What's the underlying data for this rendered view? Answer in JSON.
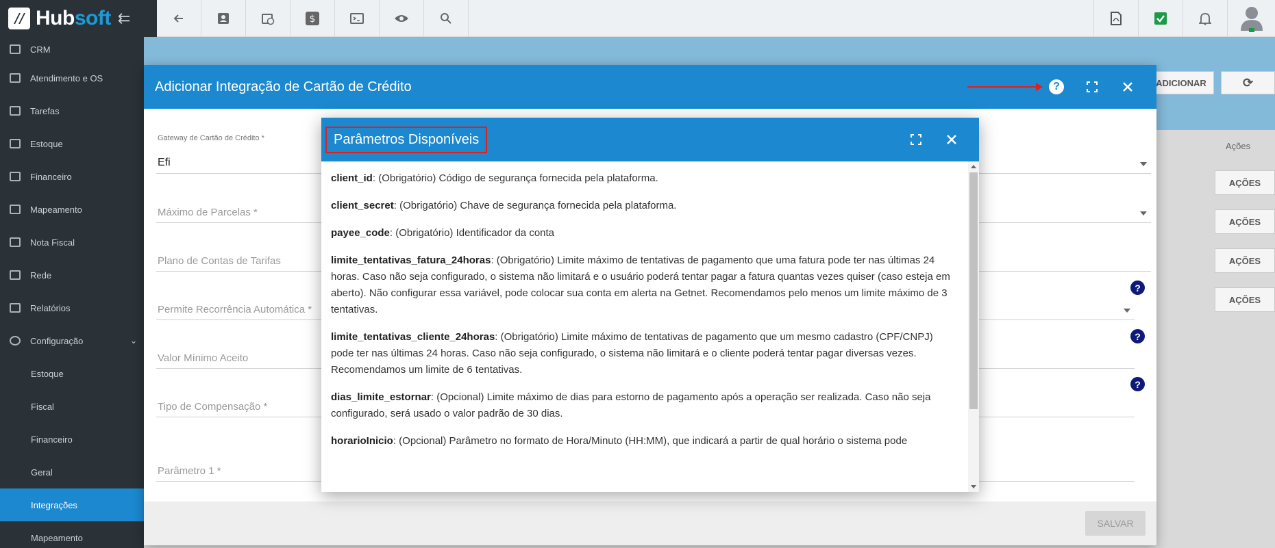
{
  "brand": {
    "name_a": "Hub",
    "name_b": "soft"
  },
  "topbar": {
    "icons": [
      "back-arrow-icon",
      "contact-card-icon",
      "clock-calendar-icon",
      "dollar-icon",
      "terminal-icon",
      "eye-icon",
      "search-icon"
    ],
    "right_icons": [
      "pdf-icon",
      "check-badge-icon",
      "bell-icon",
      "user-avatar-icon"
    ]
  },
  "sidebar": {
    "items": [
      {
        "label": "CRM"
      },
      {
        "label": "Atendimento e OS"
      },
      {
        "label": "Tarefas"
      },
      {
        "label": "Estoque"
      },
      {
        "label": "Financeiro"
      },
      {
        "label": "Mapeamento"
      },
      {
        "label": "Nota Fiscal"
      },
      {
        "label": "Rede"
      },
      {
        "label": "Relatórios"
      },
      {
        "label": "Configuração"
      }
    ],
    "subitems": [
      {
        "label": "Estoque"
      },
      {
        "label": "Fiscal"
      },
      {
        "label": "Financeiro"
      },
      {
        "label": "Geral"
      },
      {
        "label": "Integrações"
      },
      {
        "label": "Mapeamento"
      }
    ]
  },
  "background": {
    "adicionar_label": "ADICIONAR",
    "acoes_header": "Ações",
    "acoes_button": "AÇÕES"
  },
  "modal": {
    "title": "Adicionar Integração de Cartão de Crédito",
    "gateway_label": "Gateway de Cartão de Crédito *",
    "gateway_value": "Efi",
    "max_parcelas": "Máximo de Parcelas *",
    "plano_contas": "Plano de Contas de Tarifas",
    "recorrencia": "Permite Recorrência Automática *",
    "valor_minimo": "Valor Mínimo Aceito",
    "tipo_compensacao": "Tipo de Compensação *",
    "parametro1": "Parâmetro 1 *",
    "save_label": "SALVAR",
    "help_glyph": "?"
  },
  "params_dialog": {
    "title": "Parâmetros Disponíveis",
    "params": [
      {
        "name": "client_id",
        "desc": ": (Obrigatório) Código de segurança fornecida pela plataforma."
      },
      {
        "name": "client_secret",
        "desc": ": (Obrigatório) Chave de segurança fornecida pela plataforma."
      },
      {
        "name": "payee_code",
        "desc": ": (Obrigatório) Identificador da conta"
      },
      {
        "name": "limite_tentativas_fatura_24horas",
        "desc": ": (Obrigatório) Limite máximo de tentativas de pagamento que uma fatura pode ter nas últimas 24 horas. Caso não seja configurado, o sistema não limitará e o usuário poderá tentar pagar a fatura quantas vezes quiser (caso esteja em aberto). Não configurar essa variável, pode colocar sua conta em alerta na Getnet. Recomendamos pelo menos um limite máximo de 3 tentativas."
      },
      {
        "name": "limite_tentativas_cliente_24horas",
        "desc": ": (Obrigatório) Limite máximo de tentativas de pagamento que um mesmo cadastro (CPF/CNPJ) pode ter nas últimas 24 horas. Caso não seja configurado, o sistema não limitará e o cliente poderá tentar pagar diversas vezes. Recomendamos um limite de 6 tentativas."
      },
      {
        "name": "dias_limite_estornar",
        "desc": ": (Opcional) Limite máximo de dias para estorno de pagamento após a operação ser realizada. Caso não seja configurado, será usado o valor padrão de 30 dias."
      },
      {
        "name": "horarioInicio",
        "desc": ": (Opcional) Parâmetro no formato de Hora/Minuto (HH:MM), que indicará a partir de qual horário o sistema pode"
      }
    ]
  }
}
